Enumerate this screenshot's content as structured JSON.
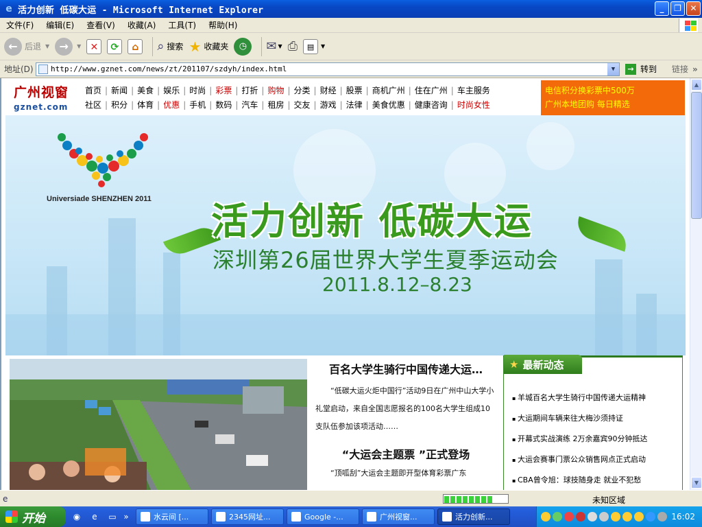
{
  "window": {
    "title": "活力创新 低碳大运 - Microsoft Internet Explorer",
    "min_label": "_",
    "max_label": "❐",
    "close_label": "✕"
  },
  "menu": [
    "文件(F)",
    "编辑(E)",
    "查看(V)",
    "收藏(A)",
    "工具(T)",
    "帮助(H)"
  ],
  "toolbar": {
    "back": "后退",
    "search": "搜索",
    "favorites": "收藏夹"
  },
  "address": {
    "label": "地址(D)",
    "url": "http://www.gznet.com/news/zt/201107/szdyh/index.html",
    "go": "转到",
    "links": "链接"
  },
  "site": {
    "logo_main": "广州视窗",
    "logo_sub": "gznet.com",
    "nav_row1": [
      {
        "t": "首页"
      },
      {
        "t": "新闻"
      },
      {
        "t": "美食"
      },
      {
        "t": "娱乐"
      },
      {
        "t": "时尚"
      },
      {
        "t": "彩票",
        "red": true
      },
      {
        "t": "打折"
      },
      {
        "t": "购物",
        "red": true
      },
      {
        "t": "分类"
      },
      {
        "t": "财经"
      },
      {
        "t": "股票"
      },
      {
        "t": "商机广州"
      },
      {
        "t": "住在广州"
      },
      {
        "t": "车主服务"
      }
    ],
    "nav_row2": [
      {
        "t": "社区"
      },
      {
        "t": "积分"
      },
      {
        "t": "体育"
      },
      {
        "t": "优惠",
        "red": true
      },
      {
        "t": "手机"
      },
      {
        "t": "数码"
      },
      {
        "t": "汽车"
      },
      {
        "t": "租房"
      },
      {
        "t": "交友"
      },
      {
        "t": "游戏"
      },
      {
        "t": "法律"
      },
      {
        "t": "美食优惠"
      },
      {
        "t": "健康咨询"
      },
      {
        "t": "时尚女性",
        "red": true
      }
    ],
    "promo_line1": "电信积分换彩票中500万",
    "promo_line2": "广州本地团购 每日精选"
  },
  "banner": {
    "logo_text": "Universiade SHENZHEN 2011",
    "title": "活力创新 低碳大运",
    "subtitle": "深圳第26届世界大学生夏季运动会",
    "dates": "2011.8.12–8.23"
  },
  "news": {
    "headline1": "百名大学生骑行中国传递大运…",
    "body1": "“低碳大运火炬中国行”活动9日在广州中山大学小礼堂启动，来自全国志愿报名的100名大学生组成10支队伍参加该项活动……",
    "headline2": "“大运会主题票 ”正式登场",
    "body2": "“顶呱刮”大运会主题即开型体育彩票广东"
  },
  "latest": {
    "tab": "最新动态",
    "items": [
      "羊城百名大学生骑行中国传递大运精神",
      "大运期间车辆来往大梅沙须持证",
      "开幕式实战演练 2万余嘉宾90分钟抵达",
      "大运会赛事门票公众销售网点正式启动",
      "CBA曾令旭：球技随身走 就业不犯愁"
    ]
  },
  "status": {
    "zone": "未知区域",
    "progress": 0.8
  },
  "taskbar": {
    "start": "开始",
    "tasks": [
      "水云间 [...",
      "2345网址...",
      "Google -...",
      "广州视窗...",
      "活力创新..."
    ],
    "clock": "16:02"
  }
}
